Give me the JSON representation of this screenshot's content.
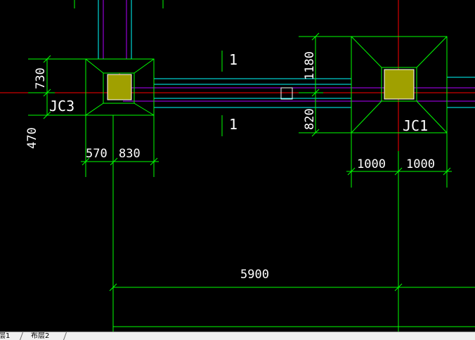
{
  "colors": {
    "background": "#000000",
    "green_lines": "#00ff00",
    "cyan_lines": "#00ffff",
    "magenta_lines": "#b000ff",
    "red_axis": "#ff0000",
    "column_fill": "#a0a000",
    "text": "#ffffff"
  },
  "labels": {
    "jc3": "JC3",
    "jc1": "JC1",
    "section_top": "1",
    "section_bottom": "1"
  },
  "dimensions": {
    "jc3_top": "730",
    "jc3_bottom": "470",
    "jc3_left": "570",
    "jc3_right": "830",
    "jc1_top": "1180",
    "jc1_bottom": "820",
    "jc1_left": "1000",
    "jc1_right": "1000",
    "span": "5900"
  },
  "tabs": [
    "层1",
    "布层2"
  ]
}
